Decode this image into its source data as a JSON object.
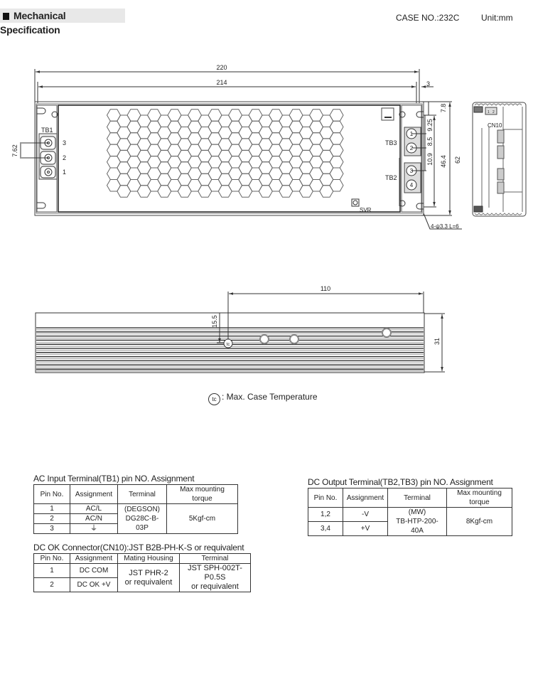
{
  "header": {
    "title": "Mechanical Specification",
    "case_no": "CASE NO.:232C",
    "unit": "Unit:mm"
  },
  "top_view": {
    "dim_overall_length": "220",
    "dim_inner_length": "214",
    "dim_end_offset": "3",
    "dim_height": "62",
    "dim_mount_spacing": "46.4",
    "dim_top_offset": "7.8",
    "dim_pin1": "9.25",
    "dim_pin12": "8.5",
    "dim_pin23": "10.9",
    "dim_tb1_pitch": "7.62",
    "mount_hole_note": "4-ψ3.3 L=6",
    "tb1_label": "TB1",
    "tb1_pins": [
      "3",
      "2",
      "1"
    ],
    "tb3_label": "TB3",
    "tb2_label": "TB2",
    "output_pins": [
      "1",
      "2",
      "3",
      "4"
    ],
    "svr_label": "SVR",
    "cn10_label": "CN10",
    "cn10_pins": [
      "1",
      "2"
    ]
  },
  "side_view": {
    "dim_tc_position": "110",
    "dim_tc_height": "15.5",
    "dim_height": "31"
  },
  "tc_legend": {
    "symbol": "tc",
    "text": ": Max. Case Temperature"
  },
  "tables": {
    "ac_input": {
      "title": "AC Input Terminal(TB1) pin NO. Assignment",
      "headers": [
        "Pin No.",
        "Assignment",
        "Terminal",
        "Max mounting torque"
      ],
      "rows": [
        {
          "pin": "1",
          "assignment": "AC/L"
        },
        {
          "pin": "2",
          "assignment": "AC/N"
        },
        {
          "pin": "3",
          "assignment": "⏚"
        }
      ],
      "terminal": [
        "(DEGSON)",
        "DG28C-B-03P"
      ],
      "torque": "5Kgf-cm"
    },
    "dc_output": {
      "title": "DC Output Terminal(TB2,TB3) pin NO. Assignment",
      "headers": [
        "Pin No.",
        "Assignment",
        "Terminal",
        "Max mounting torque"
      ],
      "rows": [
        {
          "pin": "1,2",
          "assignment": "-V"
        },
        {
          "pin": "3,4",
          "assignment": "+V"
        }
      ],
      "terminal": [
        "(MW)",
        "TB-HTP-200-40A"
      ],
      "torque": "8Kgf-cm"
    },
    "dc_ok": {
      "title": "DC OK Connector(CN10):JST B2B-PH-K-S or requivalent",
      "headers": [
        "Pin No.",
        "Assignment",
        "Mating Housing",
        "Terminal"
      ],
      "rows": [
        {
          "pin": "1",
          "assignment": "DC COM"
        },
        {
          "pin": "2",
          "assignment": "DC OK +V"
        }
      ],
      "housing": [
        "JST PHR-2",
        "or requivalent"
      ],
      "terminal": [
        "JST SPH-002T-P0.5S",
        "or requivalent"
      ]
    }
  }
}
